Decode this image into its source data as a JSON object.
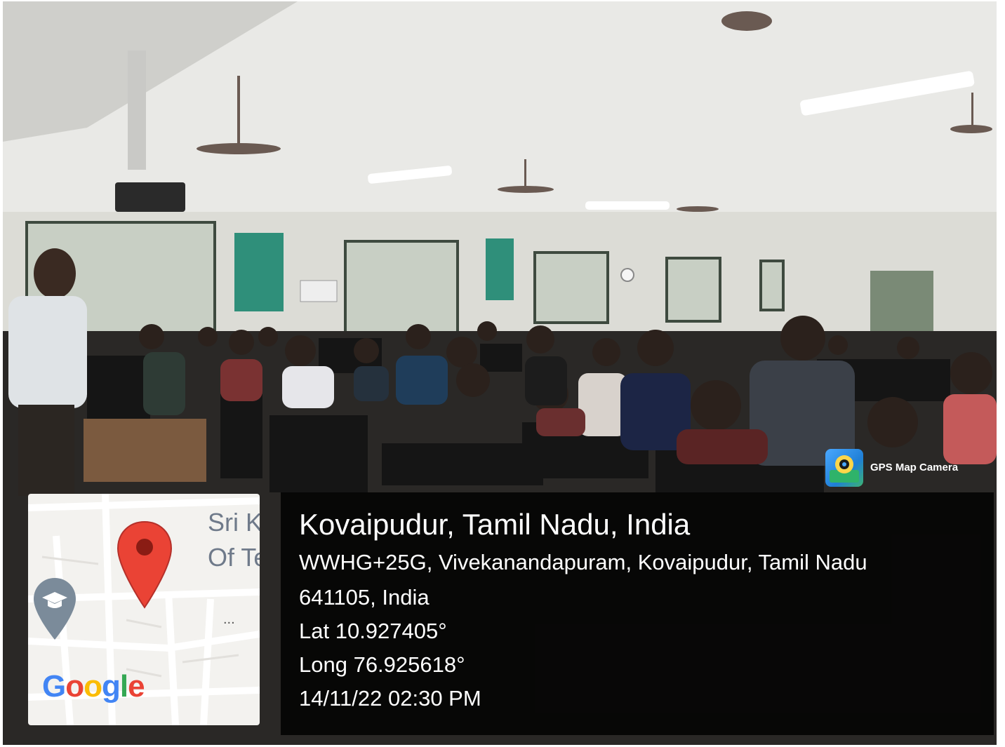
{
  "badge": {
    "label": "GPS Map Camera",
    "icon": "gps-map-camera-icon"
  },
  "map": {
    "label_line1": "Sri Kris",
    "label_line2": "Of Tec",
    "more": "...",
    "logo": [
      "G",
      "o",
      "o",
      "g",
      "l",
      "e"
    ],
    "logo_colors": [
      "#4285F4",
      "#EA4335",
      "#FBBC05",
      "#4285F4",
      "#34A853",
      "#EA4335"
    ],
    "pin_color": "#EA4335",
    "school_pin_color": "#7b8b9a"
  },
  "location": {
    "title": "Kovaipudur, Tamil Nadu, India",
    "address_line1": "WWHG+25G, Vivekanandapuram, Kovaipudur, Tamil Nadu",
    "address_line2": "641105, India",
    "lat": "Lat 10.927405°",
    "long": "Long 76.925618°",
    "datetime": "14/11/22 02:30 PM"
  }
}
